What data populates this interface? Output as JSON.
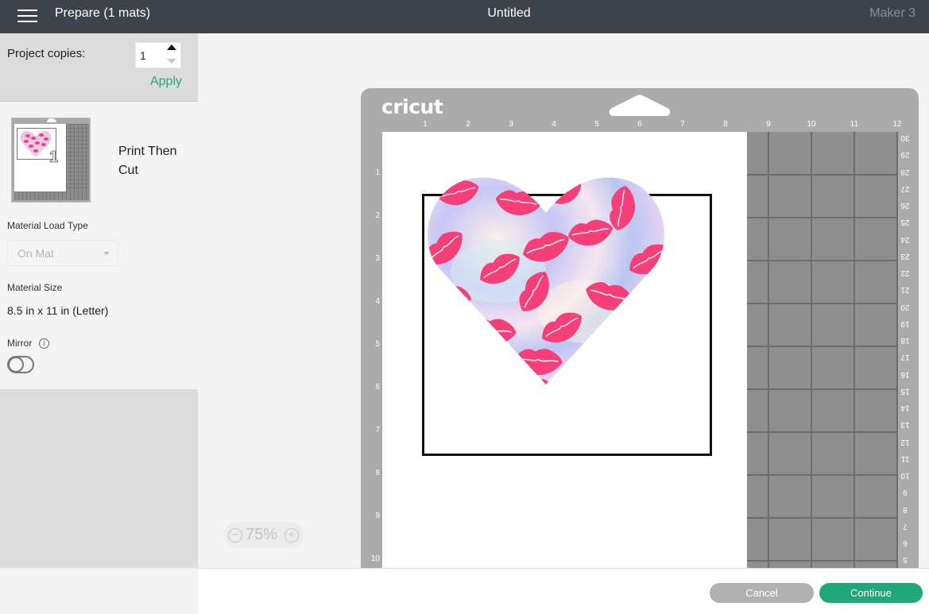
{
  "topbar": {
    "menu_icon": "hamburger-menu-icon",
    "page_title": "Prepare (1 mats)",
    "document_title": "Untitled",
    "machine_name": "Maker 3"
  },
  "sidebar": {
    "project_copies_label": "Project copies:",
    "project_copies_value": "1",
    "apply_label": "Apply",
    "mat": {
      "number": "1",
      "type_label": "Print Then Cut"
    },
    "material_load_type_label": "Material Load Type",
    "material_load_type_value": "On Mat",
    "material_size_label": "Material Size",
    "material_size_value": "8.5 in x 11 in (Letter)",
    "mirror_label": "Mirror",
    "mirror_enabled": false
  },
  "mat_preview": {
    "logo": "cricut",
    "top_ruler": [
      "1",
      "2",
      "3",
      "4",
      "5",
      "6",
      "7",
      "8",
      "9",
      "10",
      "11",
      "12"
    ],
    "left_ruler": [
      "1",
      "2",
      "3",
      "4",
      "5",
      "6",
      "7",
      "8",
      "9",
      "10"
    ],
    "right_ruler_cm": [
      "30",
      "29",
      "28",
      "27",
      "26",
      "25",
      "24",
      "23",
      "22",
      "21",
      "20",
      "19",
      "18",
      "17",
      "16",
      "15",
      "14",
      "13",
      "12",
      "11",
      "10",
      "9",
      "8",
      "7",
      "6",
      "5"
    ],
    "design": "pink lips pattern heart on holographic background"
  },
  "zoom": {
    "value": "75%",
    "minus": "−",
    "plus": "+"
  },
  "footer": {
    "cancel_label": "Cancel",
    "continue_label": "Continue"
  },
  "colors": {
    "topbar": "#3e434b",
    "accent_green": "#1fa77a",
    "lip_pink": "#f43f78"
  }
}
